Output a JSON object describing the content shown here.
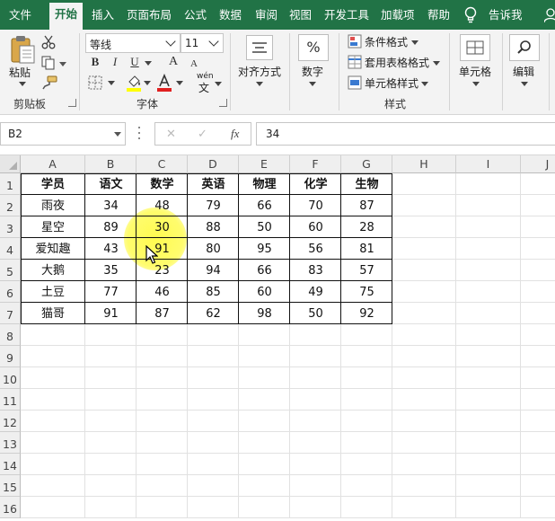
{
  "tabs": [
    "文件",
    "开始",
    "插入",
    "页面布局",
    "公式",
    "数据",
    "审阅",
    "视图",
    "开发工具",
    "加载项",
    "帮助",
    "告诉我"
  ],
  "active_tab": "开始",
  "ribbon": {
    "clipboard": {
      "paste": "粘贴",
      "group": "剪贴板"
    },
    "font": {
      "name": "等线",
      "size": "11",
      "bold": "B",
      "italic": "I",
      "underline": "U",
      "grow": "A",
      "shrink": "A",
      "phonetic": "wén",
      "group": "字体"
    },
    "alignment": {
      "label": "对齐方式"
    },
    "number": {
      "label": "数字",
      "glyph": "%"
    },
    "styles": {
      "conditional": "条件格式",
      "table": "套用表格格式",
      "cell": "单元格样式",
      "group": "样式"
    },
    "cells": {
      "label": "单元格"
    },
    "editing": {
      "label": "编辑"
    }
  },
  "formula_bar": {
    "name_box": "B2",
    "cancel": "✕",
    "confirm": "✓",
    "fx": "fx",
    "content": "34"
  },
  "grid": {
    "columns": [
      "A",
      "B",
      "C",
      "D",
      "E",
      "F",
      "G",
      "H",
      "I",
      "J"
    ],
    "rows": [
      "1",
      "2",
      "3",
      "4",
      "5",
      "6",
      "7",
      "8",
      "9",
      "10",
      "11",
      "12",
      "13",
      "14",
      "15",
      "16"
    ],
    "table": [
      [
        "学员",
        "语文",
        "数学",
        "英语",
        "物理",
        "化学",
        "生物"
      ],
      [
        "雨夜",
        "34",
        "48",
        "79",
        "66",
        "70",
        "87"
      ],
      [
        "星空",
        "89",
        "30",
        "88",
        "50",
        "60",
        "28"
      ],
      [
        "爱知趣",
        "43",
        "91",
        "80",
        "95",
        "56",
        "81"
      ],
      [
        "大鹅",
        "35",
        "23",
        "94",
        "66",
        "83",
        "57"
      ],
      [
        "土豆",
        "77",
        "46",
        "85",
        "60",
        "49",
        "75"
      ],
      [
        "猫哥",
        "91",
        "87",
        "62",
        "98",
        "50",
        "92"
      ]
    ]
  },
  "colors": {
    "accent": "#217346",
    "highlight": "#fff820",
    "border": "#111111"
  }
}
